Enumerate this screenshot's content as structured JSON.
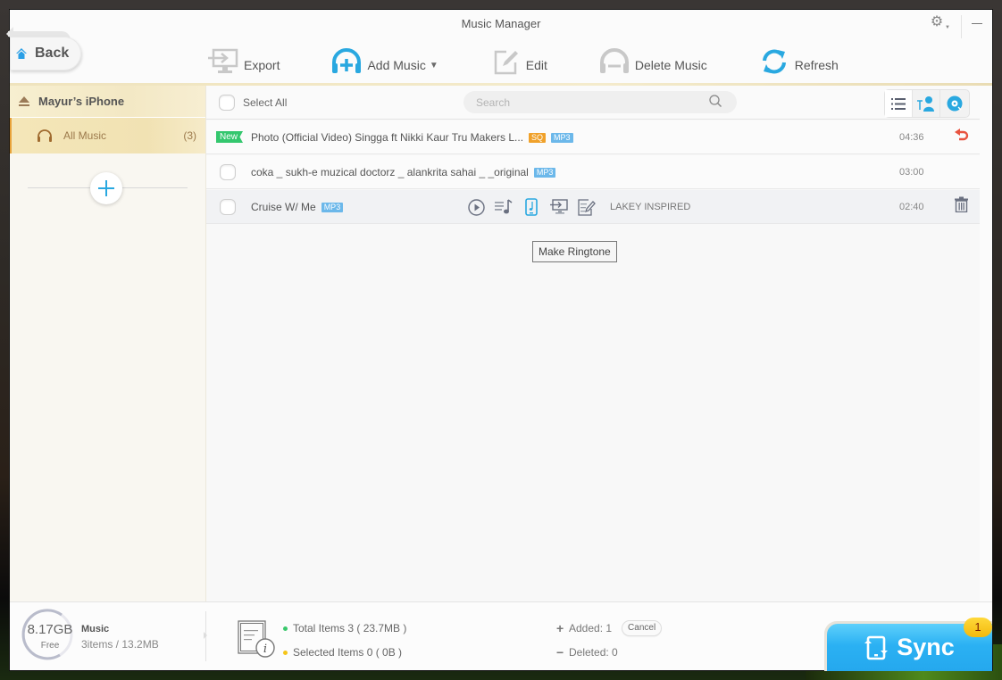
{
  "window": {
    "title": "Music Manager"
  },
  "nav": {
    "back_label": "Back"
  },
  "toolbar": {
    "items": [
      {
        "label": "Export",
        "icon": "export-icon",
        "enabled": false
      },
      {
        "label": "Add Music",
        "icon": "add-music-icon",
        "enabled": true,
        "has_dropdown": true
      },
      {
        "label": "Edit",
        "icon": "edit-icon",
        "enabled": false
      },
      {
        "label": "Delete Music",
        "icon": "delete-music-icon",
        "enabled": false
      },
      {
        "label": "Refresh",
        "icon": "refresh-icon",
        "enabled": true
      }
    ]
  },
  "sidebar": {
    "device_name": "Mayur’s iPhone",
    "items": [
      {
        "label": "All Music",
        "count": "(3)",
        "icon": "headphones-icon",
        "active": true
      }
    ]
  },
  "list": {
    "select_all_label": "Select All",
    "search_placeholder": "Search",
    "view_modes": [
      "list-view-icon",
      "artist-view-icon",
      "album-view-icon"
    ],
    "active_view": "list-view-icon",
    "rows": [
      {
        "title": "Photo (Official Video)  Singga ft Nikki Kaur  Tru Makers  L...",
        "tags": [
          "SQ",
          "MP3"
        ],
        "badge": "New",
        "duration": "04:36",
        "action_icon": "undo-icon"
      },
      {
        "title": "coka _ sukh-e muzical doctorz _ alankrita sahai _ _original",
        "tags": [
          "MP3"
        ],
        "duration": "03:00"
      },
      {
        "title": "Cruise W/ Me",
        "tags": [
          "MP3"
        ],
        "artist": "LAKEY INSPIRED",
        "duration": "02:40",
        "action_icon": "trash-icon",
        "hovered": true,
        "row_actions": [
          "play-icon",
          "add-to-playlist-icon",
          "make-ringtone-icon",
          "export-to-pc-icon",
          "edit-info-icon"
        ]
      }
    ],
    "tooltip": "Make Ringtone"
  },
  "footer": {
    "storage_free_value": "8.17GB",
    "storage_free_label": "Free",
    "category_name": "Music",
    "category_info": "3items / 13.2MB",
    "total_items": "Total Items 3 ( 23.7MB )",
    "selected_items": "Selected Items 0 ( 0B )",
    "added": "Added: 1",
    "deleted": "Deleted: 0",
    "cancel_label": "Cancel",
    "sync_label": "Sync",
    "sync_badge": "1"
  },
  "colors": {
    "accent_blue": "#29a8e0",
    "new_badge_green": "#34c76e",
    "sq_tag_orange": "#f0a12a",
    "mp3_tag_blue": "#6cb8ea",
    "undo_red": "#e8533f",
    "total_dot_green": "#3ac86c",
    "selected_dot_yellow": "#f5c518",
    "sync_badge_yellow": "#f7c51c"
  }
}
